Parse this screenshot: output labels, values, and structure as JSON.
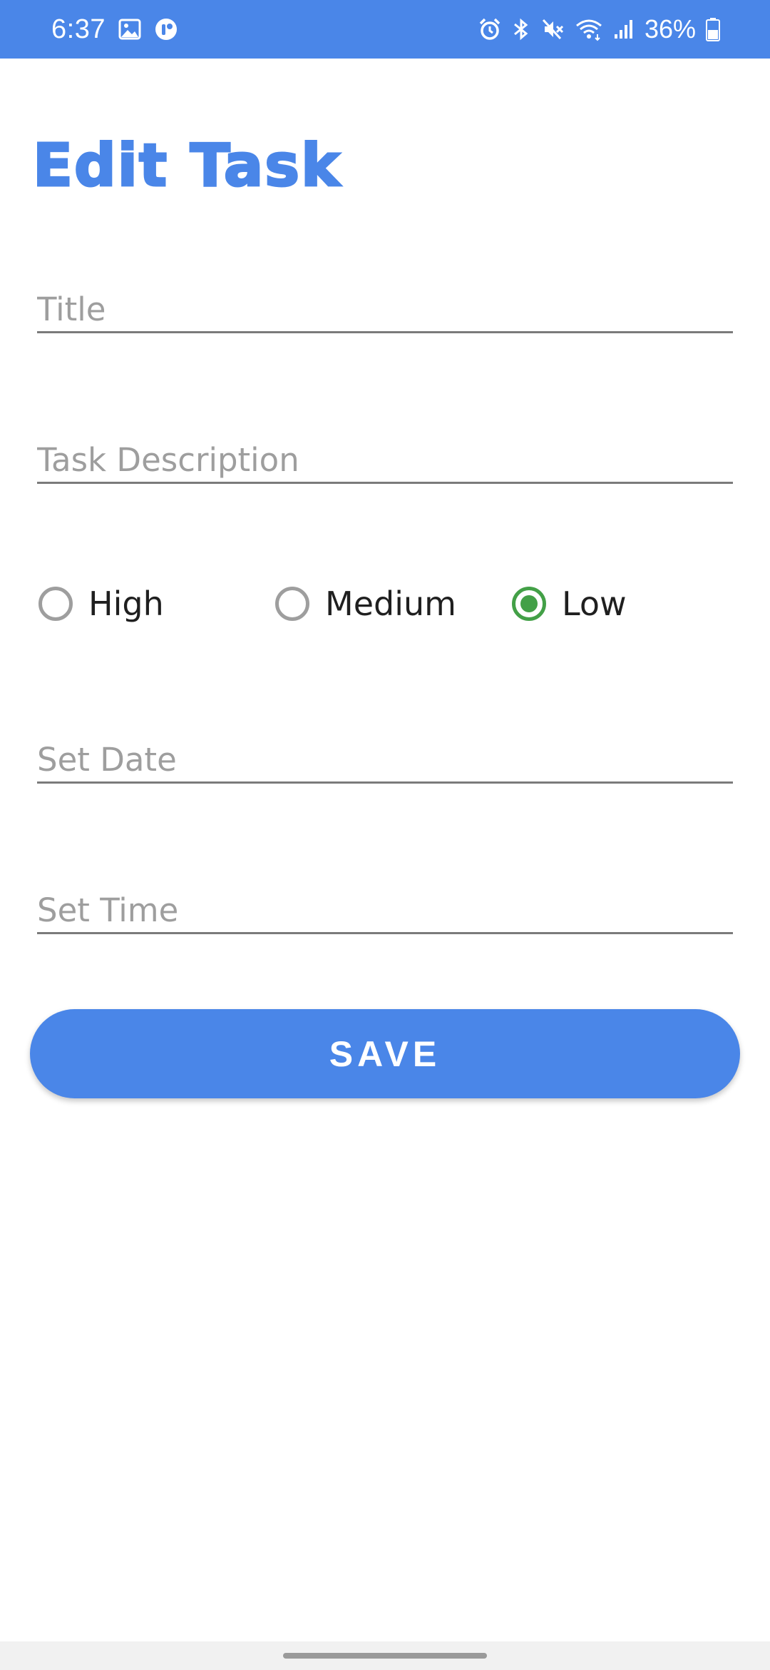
{
  "status_bar": {
    "time": "6:37",
    "battery_percent": "36%",
    "left_icons": [
      "image-icon",
      "app-notification-icon"
    ],
    "right_icons": [
      "alarm-icon",
      "bluetooth-icon",
      "mute-icon",
      "wifi-icon",
      "signal-icon",
      "battery-icon"
    ],
    "background_color": "#4a86e8"
  },
  "page": {
    "title": "Edit Task"
  },
  "form": {
    "title_field": {
      "placeholder": "Title",
      "value": ""
    },
    "description_field": {
      "placeholder": "Task Description",
      "value": ""
    },
    "priority": {
      "options": [
        {
          "label": "High",
          "checked": false
        },
        {
          "label": "Medium",
          "checked": false
        },
        {
          "label": "Low",
          "checked": true
        }
      ],
      "selected": "Low",
      "selected_color": "#43a047"
    },
    "date_field": {
      "placeholder": "Set Date",
      "value": ""
    },
    "time_field": {
      "placeholder": "Set Time",
      "value": ""
    },
    "save_label": "SAVE"
  },
  "theme": {
    "accent": "#4a86e8",
    "underline": "#7b7b7b"
  }
}
